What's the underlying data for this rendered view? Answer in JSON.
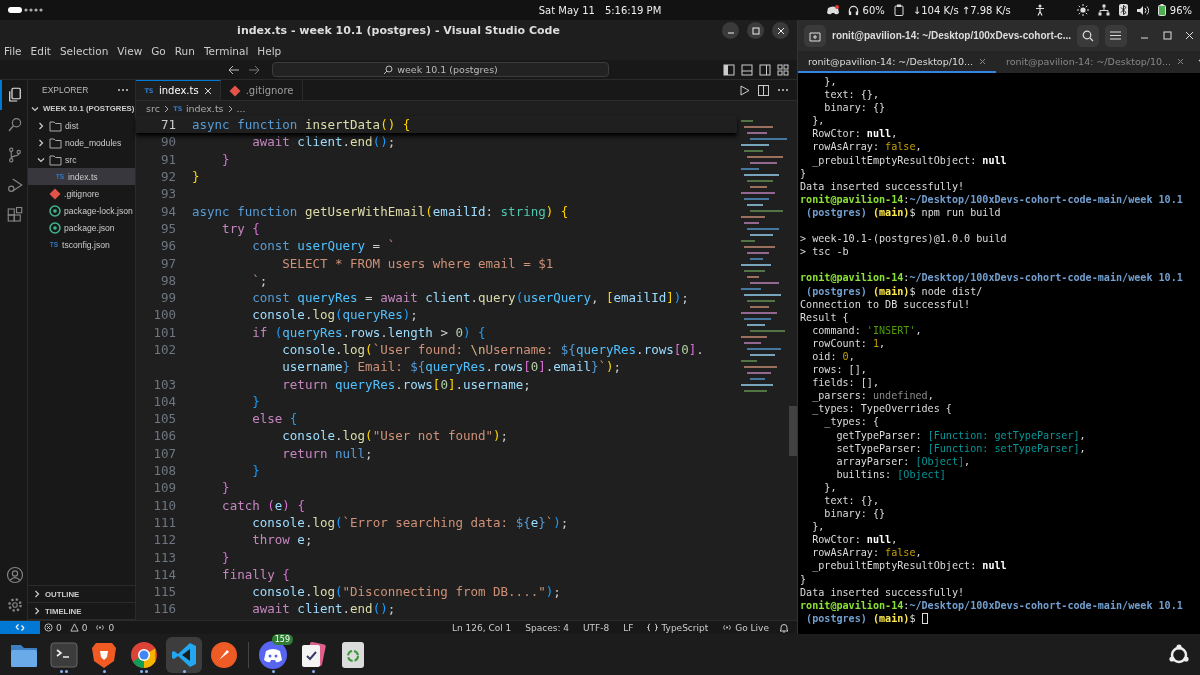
{
  "top_bar": {
    "date": "Sat May 11",
    "time": "5:16:19 PM",
    "headphones": "60%",
    "network_speed": "↓104 K/s ↑7.98 K/s",
    "battery": "96%"
  },
  "vscode": {
    "window_title": "index.ts - week 10.1 (postgres) - Visual Studio Code",
    "menu": [
      "File",
      "Edit",
      "Selection",
      "View",
      "Go",
      "Run",
      "Terminal",
      "Help"
    ],
    "command_center": "week 10.1 (postgres)",
    "activity_bar": [
      {
        "kind": "explorer",
        "selected": true
      },
      {
        "kind": "search",
        "selected": false
      },
      {
        "kind": "scm",
        "selected": false
      },
      {
        "kind": "run",
        "selected": false
      },
      {
        "kind": "extensions",
        "selected": false
      }
    ],
    "explorer": {
      "title": "EXPLORER",
      "root": {
        "label": "WEEK 10.1 (POSTGRES)",
        "expanded": true
      },
      "items": [
        {
          "label": "dist",
          "kind": "folder",
          "expanded": false
        },
        {
          "label": "node_modules",
          "kind": "folder",
          "expanded": false
        },
        {
          "label": "src",
          "kind": "folder",
          "expanded": true,
          "children": [
            {
              "label": "index.ts",
              "kind": "ts",
              "badge": "TS",
              "selected": true
            }
          ]
        },
        {
          "label": ".gitignore",
          "kind": "git",
          "selected": false
        },
        {
          "label": "package-lock.json",
          "kind": "json",
          "selected": false
        },
        {
          "label": "package.json",
          "kind": "json",
          "selected": false
        },
        {
          "label": "tsconfig.json",
          "kind": "ts",
          "badge": "TS",
          "selected": false
        }
      ],
      "sections": [
        {
          "label": "OUTLINE",
          "expanded": false
        },
        {
          "label": "TIMELINE",
          "expanded": false
        }
      ]
    },
    "tabs": [
      {
        "label": "index.ts",
        "kind": "ts",
        "badge": "TS",
        "selected": true
      },
      {
        "label": ".gitignore",
        "kind": "git",
        "selected": false
      }
    ],
    "breadcrumbs": [
      {
        "label": "src",
        "kind": "folder"
      },
      {
        "label": "index.ts",
        "kind": "ts",
        "badge": "TS"
      },
      {
        "label": "...",
        "kind": "more"
      }
    ],
    "sticky_line": {
      "number": "71",
      "tokens": [
        {
          "text": "async ",
          "kind": "kw"
        },
        {
          "text": "function ",
          "kind": "kw"
        },
        {
          "text": "insertData",
          "kind": "fn"
        },
        {
          "text": "() ",
          "kind": "b1"
        },
        {
          "text": "{",
          "kind": "b1"
        }
      ]
    },
    "code": [
      {
        "number": "90",
        "tokens": [
          {
            "text": "        await ",
            "kind": "ctl"
          },
          {
            "text": "client",
            "kind": "var"
          },
          {
            "text": ".",
            "kind": "p"
          },
          {
            "text": "end",
            "kind": "fn"
          },
          {
            "text": "()",
            "kind": "b3"
          },
          {
            "text": ";",
            "kind": "p"
          }
        ]
      },
      {
        "number": "91",
        "tokens": [
          {
            "text": "    }",
            "kind": "b2"
          }
        ]
      },
      {
        "number": "92",
        "tokens": [
          {
            "text": "}",
            "kind": "b1"
          }
        ]
      },
      {
        "number": "93"
      },
      {
        "number": "94",
        "tokens": [
          {
            "text": "async ",
            "kind": "kw"
          },
          {
            "text": "function ",
            "kind": "kw"
          },
          {
            "text": "getUserWithEmail",
            "kind": "fn"
          },
          {
            "text": "(",
            "kind": "b1"
          },
          {
            "text": "emailId",
            "kind": "var"
          },
          {
            "text": ": ",
            "kind": "p"
          },
          {
            "text": "string",
            "kind": "type"
          },
          {
            "text": ") ",
            "kind": "b1"
          },
          {
            "text": "{",
            "kind": "b1"
          }
        ]
      },
      {
        "number": "95",
        "tokens": [
          {
            "text": "    try ",
            "kind": "ctl"
          },
          {
            "text": "{",
            "kind": "b2"
          }
        ]
      },
      {
        "number": "96",
        "tokens": [
          {
            "text": "        const ",
            "kind": "kw"
          },
          {
            "text": "userQuery",
            "kind": "cst"
          },
          {
            "text": " = ",
            "kind": "p"
          },
          {
            "text": "`",
            "kind": "str"
          }
        ]
      },
      {
        "number": "97",
        "tokens": [
          {
            "text": "            SELECT * FROM users where email = $1",
            "kind": "str"
          }
        ]
      },
      {
        "number": "98",
        "tokens": [
          {
            "text": "        `",
            "kind": "str"
          },
          {
            "text": ";",
            "kind": "p"
          }
        ]
      },
      {
        "number": "99",
        "tokens": [
          {
            "text": "        const ",
            "kind": "kw"
          },
          {
            "text": "queryRes",
            "kind": "cst"
          },
          {
            "text": " = ",
            "kind": "p"
          },
          {
            "text": "await ",
            "kind": "ctl"
          },
          {
            "text": "client",
            "kind": "var"
          },
          {
            "text": ".",
            "kind": "p"
          },
          {
            "text": "query",
            "kind": "fn"
          },
          {
            "text": "(",
            "kind": "b3"
          },
          {
            "text": "userQuery",
            "kind": "cst"
          },
          {
            "text": ", ",
            "kind": "p"
          },
          {
            "text": "[",
            "kind": "b1"
          },
          {
            "text": "emailId",
            "kind": "var"
          },
          {
            "text": "]",
            "kind": "b1"
          },
          {
            "text": ")",
            "kind": "b3"
          },
          {
            "text": ";",
            "kind": "p"
          }
        ]
      },
      {
        "number": "100",
        "tokens": [
          {
            "text": "        console",
            "kind": "var"
          },
          {
            "text": ".",
            "kind": "p"
          },
          {
            "text": "log",
            "kind": "fn"
          },
          {
            "text": "(",
            "kind": "b3"
          },
          {
            "text": "queryRes",
            "kind": "cst"
          },
          {
            "text": ")",
            "kind": "b3"
          },
          {
            "text": ";",
            "kind": "p"
          }
        ]
      },
      {
        "number": "101",
        "tokens": [
          {
            "text": "        if ",
            "kind": "ctl"
          },
          {
            "text": "(",
            "kind": "b3"
          },
          {
            "text": "queryRes",
            "kind": "cst"
          },
          {
            "text": ".",
            "kind": "p"
          },
          {
            "text": "rows",
            "kind": "var"
          },
          {
            "text": ".",
            "kind": "p"
          },
          {
            "text": "length",
            "kind": "var"
          },
          {
            "text": " > ",
            "kind": "p"
          },
          {
            "text": "0",
            "kind": "num"
          },
          {
            "text": ") ",
            "kind": "b3"
          },
          {
            "text": "{",
            "kind": "b3"
          }
        ]
      },
      {
        "number": "102",
        "tokens": [
          {
            "text": "            console",
            "kind": "var"
          },
          {
            "text": ".",
            "kind": "p"
          },
          {
            "text": "log",
            "kind": "fn"
          },
          {
            "text": "(",
            "kind": "b1"
          },
          {
            "text": "`User found: ",
            "kind": "str"
          },
          {
            "text": "\\n",
            "kind": "esc"
          },
          {
            "text": "Username: ",
            "kind": "str"
          },
          {
            "text": "${",
            "kind": "kw"
          },
          {
            "text": "queryRes",
            "kind": "cst"
          },
          {
            "text": ".",
            "kind": "p"
          },
          {
            "text": "rows",
            "kind": "var"
          },
          {
            "text": "[",
            "kind": "b2"
          },
          {
            "text": "0",
            "kind": "num"
          },
          {
            "text": "]",
            "kind": "b2"
          },
          {
            "text": ".",
            "kind": "p"
          }
        ]
      },
      {
        "tokens": [
          {
            "text": "            username",
            "kind": "var"
          },
          {
            "text": "}",
            "kind": "kw"
          },
          {
            "text": " Email: ",
            "kind": "str"
          },
          {
            "text": "${",
            "kind": "kw"
          },
          {
            "text": "queryRes",
            "kind": "cst"
          },
          {
            "text": ".",
            "kind": "p"
          },
          {
            "text": "rows",
            "kind": "var"
          },
          {
            "text": "[",
            "kind": "b2"
          },
          {
            "text": "0",
            "kind": "num"
          },
          {
            "text": "]",
            "kind": "b2"
          },
          {
            "text": ".",
            "kind": "p"
          },
          {
            "text": "email",
            "kind": "var"
          },
          {
            "text": "}",
            "kind": "kw"
          },
          {
            "text": "`",
            "kind": "str"
          },
          {
            "text": ")",
            "kind": "b1"
          },
          {
            "text": ";",
            "kind": "p"
          }
        ]
      },
      {
        "number": "103",
        "tokens": [
          {
            "text": "            return ",
            "kind": "ctl"
          },
          {
            "text": "queryRes",
            "kind": "cst"
          },
          {
            "text": ".",
            "kind": "p"
          },
          {
            "text": "rows",
            "kind": "var"
          },
          {
            "text": "[",
            "kind": "b1"
          },
          {
            "text": "0",
            "kind": "num"
          },
          {
            "text": "]",
            "kind": "b1"
          },
          {
            "text": ".",
            "kind": "p"
          },
          {
            "text": "username",
            "kind": "var"
          },
          {
            "text": ";",
            "kind": "p"
          }
        ]
      },
      {
        "number": "104",
        "tokens": [
          {
            "text": "        }",
            "kind": "b3"
          }
        ]
      },
      {
        "number": "105",
        "tokens": [
          {
            "text": "        else ",
            "kind": "ctl"
          },
          {
            "text": "{",
            "kind": "b3"
          }
        ]
      },
      {
        "number": "106",
        "tokens": [
          {
            "text": "            console",
            "kind": "var"
          },
          {
            "text": ".",
            "kind": "p"
          },
          {
            "text": "log",
            "kind": "fn"
          },
          {
            "text": "(",
            "kind": "b1"
          },
          {
            "text": "\"User not found\"",
            "kind": "str"
          },
          {
            "text": ")",
            "kind": "b1"
          },
          {
            "text": ";",
            "kind": "p"
          }
        ]
      },
      {
        "number": "107",
        "tokens": [
          {
            "text": "            return ",
            "kind": "ctl"
          },
          {
            "text": "null",
            "kind": "kw"
          },
          {
            "text": ";",
            "kind": "p"
          }
        ]
      },
      {
        "number": "108",
        "tokens": [
          {
            "text": "        }",
            "kind": "b3"
          }
        ]
      },
      {
        "number": "109",
        "tokens": [
          {
            "text": "    }",
            "kind": "b2"
          }
        ]
      },
      {
        "number": "110",
        "tokens": [
          {
            "text": "    catch ",
            "kind": "ctl"
          },
          {
            "text": "(",
            "kind": "b2"
          },
          {
            "text": "e",
            "kind": "var"
          },
          {
            "text": ") ",
            "kind": "b2"
          },
          {
            "text": "{",
            "kind": "b2"
          }
        ]
      },
      {
        "number": "111",
        "tokens": [
          {
            "text": "        console",
            "kind": "var"
          },
          {
            "text": ".",
            "kind": "p"
          },
          {
            "text": "log",
            "kind": "fn"
          },
          {
            "text": "(",
            "kind": "b3"
          },
          {
            "text": "`Error searching data: ",
            "kind": "str"
          },
          {
            "text": "${",
            "kind": "kw"
          },
          {
            "text": "e",
            "kind": "var"
          },
          {
            "text": "}",
            "kind": "kw"
          },
          {
            "text": "`",
            "kind": "str"
          },
          {
            "text": ")",
            "kind": "b3"
          },
          {
            "text": ";",
            "kind": "p"
          }
        ]
      },
      {
        "number": "112",
        "tokens": [
          {
            "text": "        throw ",
            "kind": "ctl"
          },
          {
            "text": "e",
            "kind": "var"
          },
          {
            "text": ";",
            "kind": "p"
          }
        ]
      },
      {
        "number": "113",
        "tokens": [
          {
            "text": "    }",
            "kind": "b2"
          }
        ]
      },
      {
        "number": "114",
        "tokens": [
          {
            "text": "    finally ",
            "kind": "ctl"
          },
          {
            "text": "{",
            "kind": "b2"
          }
        ]
      },
      {
        "number": "115",
        "tokens": [
          {
            "text": "        console",
            "kind": "var"
          },
          {
            "text": ".",
            "kind": "p"
          },
          {
            "text": "log",
            "kind": "fn"
          },
          {
            "text": "(",
            "kind": "b3"
          },
          {
            "text": "\"Disconnecting from DB....\"",
            "kind": "str"
          },
          {
            "text": ")",
            "kind": "b3"
          },
          {
            "text": ";",
            "kind": "p"
          }
        ]
      },
      {
        "number": "116",
        "tokens": [
          {
            "text": "        await ",
            "kind": "ctl"
          },
          {
            "text": "client",
            "kind": "var"
          },
          {
            "text": ".",
            "kind": "p"
          },
          {
            "text": "end",
            "kind": "fn"
          },
          {
            "text": "()",
            "kind": "b3"
          },
          {
            "text": ";",
            "kind": "p"
          }
        ]
      }
    ],
    "status_bar": {
      "errors": "0",
      "warnings": "0",
      "ports": "0",
      "right": [
        {
          "text": "Ln 126, Col 1",
          "kind": "text"
        },
        {
          "text": "Spaces: 4",
          "kind": "text"
        },
        {
          "text": "UTF-8",
          "kind": "text"
        },
        {
          "text": "LF",
          "kind": "text"
        },
        {
          "text": "TypeScript",
          "kind": "language"
        },
        {
          "text": "Go Live",
          "kind": "live"
        }
      ]
    }
  },
  "terminal": {
    "title": "ronit@pavilion-14: ~/Desktop/100xDevs-cohort-c...",
    "tabs": [
      {
        "label": "ronit@pavilion-14: ~/Desktop/10...",
        "selected": true
      },
      {
        "label": "ronit@pavilion-14: ~/Desktop/10...",
        "selected": false
      }
    ],
    "lines": [
      [
        {
          "text": "    },",
          "kind": "p"
        }
      ],
      [
        {
          "text": "    text: {},",
          "kind": "p"
        }
      ],
      [
        {
          "text": "    binary: {}",
          "kind": "p"
        }
      ],
      [
        {
          "text": "  },",
          "kind": "p"
        }
      ],
      [
        {
          "text": "  RowCtor: ",
          "kind": "p"
        },
        {
          "text": "null",
          "kind": "b"
        },
        {
          "text": ",",
          "kind": "p"
        }
      ],
      [
        {
          "text": "  rowAsArray: ",
          "kind": "p"
        },
        {
          "text": "false",
          "kind": "bool"
        },
        {
          "text": ",",
          "kind": "p"
        }
      ],
      [
        {
          "text": "  _prebuiltEmptyResultObject: ",
          "kind": "p"
        },
        {
          "text": "null",
          "kind": "b"
        }
      ],
      [
        {
          "text": "}",
          "kind": "p"
        }
      ],
      [
        {
          "text": "Data inserted successfully!",
          "kind": "p"
        }
      ],
      [
        {
          "text": "ronit@pavilion-14",
          "kind": "user"
        },
        {
          "text": ":",
          "kind": "p"
        },
        {
          "text": "~/Desktop/100xDevs-cohort-code-main/week 10.1",
          "kind": "path"
        }
      ],
      [
        {
          "text": " (postgres) ",
          "kind": "path"
        },
        {
          "text": "(main)",
          "kind": "branch"
        },
        {
          "text": "$ npm run build",
          "kind": "p"
        }
      ],
      [
        {
          "text": "> week-10.1-(postgres)@1.0.0 build",
          "kind": "p",
          "blank_before": true
        }
      ],
      [
        {
          "text": "> tsc -b",
          "kind": "p"
        }
      ],
      [
        {
          "text": "ronit@pavilion-14",
          "kind": "user",
          "blank_before": true
        },
        {
          "text": ":",
          "kind": "p"
        },
        {
          "text": "~/Desktop/100xDevs-cohort-code-main/week 10.1",
          "kind": "path"
        }
      ],
      [
        {
          "text": " (postgres) ",
          "kind": "path"
        },
        {
          "text": "(main)",
          "kind": "branch"
        },
        {
          "text": "$ node dist/",
          "kind": "p"
        }
      ],
      [
        {
          "text": "Connection to DB successful!",
          "kind": "p"
        }
      ],
      [
        {
          "text": "Result {",
          "kind": "p"
        }
      ],
      [
        {
          "text": "  command: ",
          "kind": "p"
        },
        {
          "text": "'INSERT'",
          "kind": "str"
        },
        {
          "text": ",",
          "kind": "p"
        }
      ],
      [
        {
          "text": "  rowCount: ",
          "kind": "p"
        },
        {
          "text": "1",
          "kind": "num"
        },
        {
          "text": ",",
          "kind": "p"
        }
      ],
      [
        {
          "text": "  oid: ",
          "kind": "p"
        },
        {
          "text": "0",
          "kind": "num"
        },
        {
          "text": ",",
          "kind": "p"
        }
      ],
      [
        {
          "text": "  rows: [],",
          "kind": "p"
        }
      ],
      [
        {
          "text": "  fields: [],",
          "kind": "p"
        }
      ],
      [
        {
          "text": "  _parsers: ",
          "kind": "p"
        },
        {
          "text": "undefined",
          "kind": "undef"
        },
        {
          "text": ",",
          "kind": "p"
        }
      ],
      [
        {
          "text": "  _types: TypeOverrides {",
          "kind": "p"
        }
      ],
      [
        {
          "text": "    _types: {",
          "kind": "p"
        }
      ],
      [
        {
          "text": "      getTypeParser: ",
          "kind": "p"
        },
        {
          "text": "[Function: getTypeParser]",
          "kind": "special"
        },
        {
          "text": ",",
          "kind": "p"
        }
      ],
      [
        {
          "text": "      setTypeParser: ",
          "kind": "p"
        },
        {
          "text": "[Function: setTypeParser]",
          "kind": "special"
        },
        {
          "text": ",",
          "kind": "p"
        }
      ],
      [
        {
          "text": "      arrayParser: ",
          "kind": "p"
        },
        {
          "text": "[Object]",
          "kind": "special"
        },
        {
          "text": ",",
          "kind": "p"
        }
      ],
      [
        {
          "text": "      builtins: ",
          "kind": "p"
        },
        {
          "text": "[Object]",
          "kind": "special"
        }
      ],
      [
        {
          "text": "    },",
          "kind": "p"
        }
      ],
      [
        {
          "text": "    text: {},",
          "kind": "p"
        }
      ],
      [
        {
          "text": "    binary: {}",
          "kind": "p"
        }
      ],
      [
        {
          "text": "  },",
          "kind": "p"
        }
      ],
      [
        {
          "text": "  RowCtor: ",
          "kind": "p"
        },
        {
          "text": "null",
          "kind": "b"
        },
        {
          "text": ",",
          "kind": "p"
        }
      ],
      [
        {
          "text": "  rowAsArray: ",
          "kind": "p"
        },
        {
          "text": "false",
          "kind": "bool"
        },
        {
          "text": ",",
          "kind": "p"
        }
      ],
      [
        {
          "text": "  _prebuiltEmptyResultObject: ",
          "kind": "p"
        },
        {
          "text": "null",
          "kind": "b"
        }
      ],
      [
        {
          "text": "}",
          "kind": "p"
        }
      ],
      [
        {
          "text": "Data inserted successfully!",
          "kind": "p"
        }
      ],
      [
        {
          "text": "ronit@pavilion-14",
          "kind": "user"
        },
        {
          "text": ":",
          "kind": "p"
        },
        {
          "text": "~/Desktop/100xDevs-cohort-code-main/week 10.1",
          "kind": "path"
        }
      ],
      [
        {
          "text": " (postgres) ",
          "kind": "path"
        },
        {
          "text": "(main)",
          "kind": "branch"
        },
        {
          "text": "$ ",
          "kind": "p"
        },
        {
          "kind": "cursor"
        }
      ]
    ]
  },
  "dock": {
    "apps": [
      {
        "kind": "files",
        "running": false,
        "selected": false
      },
      {
        "kind": "terminal",
        "running": true,
        "multiple_windows": true,
        "selected": false
      },
      {
        "kind": "shield",
        "running": true,
        "multiple_windows": false,
        "selected": false
      },
      {
        "kind": "browser",
        "running": true,
        "multiple_windows": true,
        "selected": false
      },
      {
        "kind": "editor",
        "running": true,
        "multiple_windows": false,
        "selected": true
      },
      {
        "kind": "rocket",
        "running": false,
        "selected": false
      },
      {
        "kind": "chat",
        "running": true,
        "multiple_windows": false,
        "selected": false,
        "badge": "159"
      },
      {
        "kind": "tasks",
        "running": true,
        "multiple_windows": false,
        "selected": false
      },
      {
        "kind": "trash",
        "running": false,
        "selected": false
      }
    ]
  }
}
